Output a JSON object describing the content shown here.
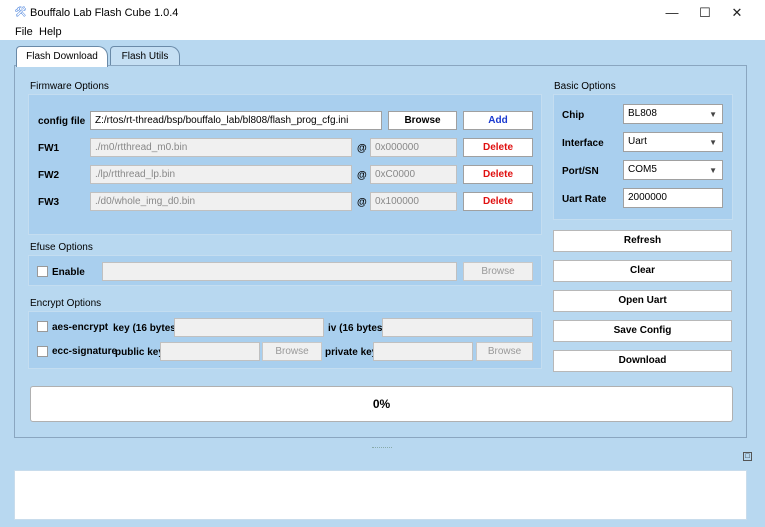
{
  "window": {
    "title": "Bouffalo Lab Flash Cube 1.0.4",
    "controls": {
      "minimize": "—",
      "maximize": "☐",
      "close": "✕"
    }
  },
  "menu": {
    "file": "File",
    "help": "Help"
  },
  "tabs": [
    {
      "label": "Flash Download",
      "active": true
    },
    {
      "label": "Flash Utils",
      "active": false
    }
  ],
  "firmware": {
    "section_title": "Firmware Options",
    "config": {
      "label": "config file",
      "value": "Z:/rtos/rt-thread/bsp/bouffalo_lab/bl808/flash_prog_cfg.ini",
      "browse": "Browse",
      "add": "Add"
    },
    "rows": [
      {
        "label": "FW1",
        "path": "./m0/rtthread_m0.bin",
        "at": "@",
        "addr": "0x000000",
        "delete": "Delete"
      },
      {
        "label": "FW2",
        "path": "./lp/rtthread_lp.bin",
        "at": "@",
        "addr": "0xC0000",
        "delete": "Delete"
      },
      {
        "label": "FW3",
        "path": "./d0/whole_img_d0.bin",
        "at": "@",
        "addr": "0x100000",
        "delete": "Delete"
      }
    ]
  },
  "efuse": {
    "section_title": "Efuse Options",
    "enable_label": "Enable",
    "enabled": false,
    "browse": "Browse"
  },
  "encrypt": {
    "section_title": "Encrypt Options",
    "aes_label": "aes-encrypt",
    "key_label": "key (16 bytes)",
    "iv_label": "iv (16 bytes)",
    "ecc_label": "ecc-signature",
    "public_key_label": "public key",
    "public_browse": "Browse",
    "private_key_label": "private key",
    "private_browse": "Browse"
  },
  "basic": {
    "section_title": "Basic Options",
    "chip": {
      "label": "Chip",
      "value": "BL808"
    },
    "interface": {
      "label": "Interface",
      "value": "Uart"
    },
    "port": {
      "label": "Port/SN",
      "value": "COM5"
    },
    "rate": {
      "label": "Uart Rate",
      "value": "2000000"
    }
  },
  "actions": {
    "refresh": "Refresh",
    "clear": "Clear",
    "open_uart": "Open Uart",
    "save_config": "Save Config",
    "download": "Download"
  },
  "progress": {
    "text": "0%",
    "value": 0
  },
  "colors": {
    "delete": "#e01010",
    "add": "#1a3ad0",
    "background": "#b8d8f0"
  }
}
